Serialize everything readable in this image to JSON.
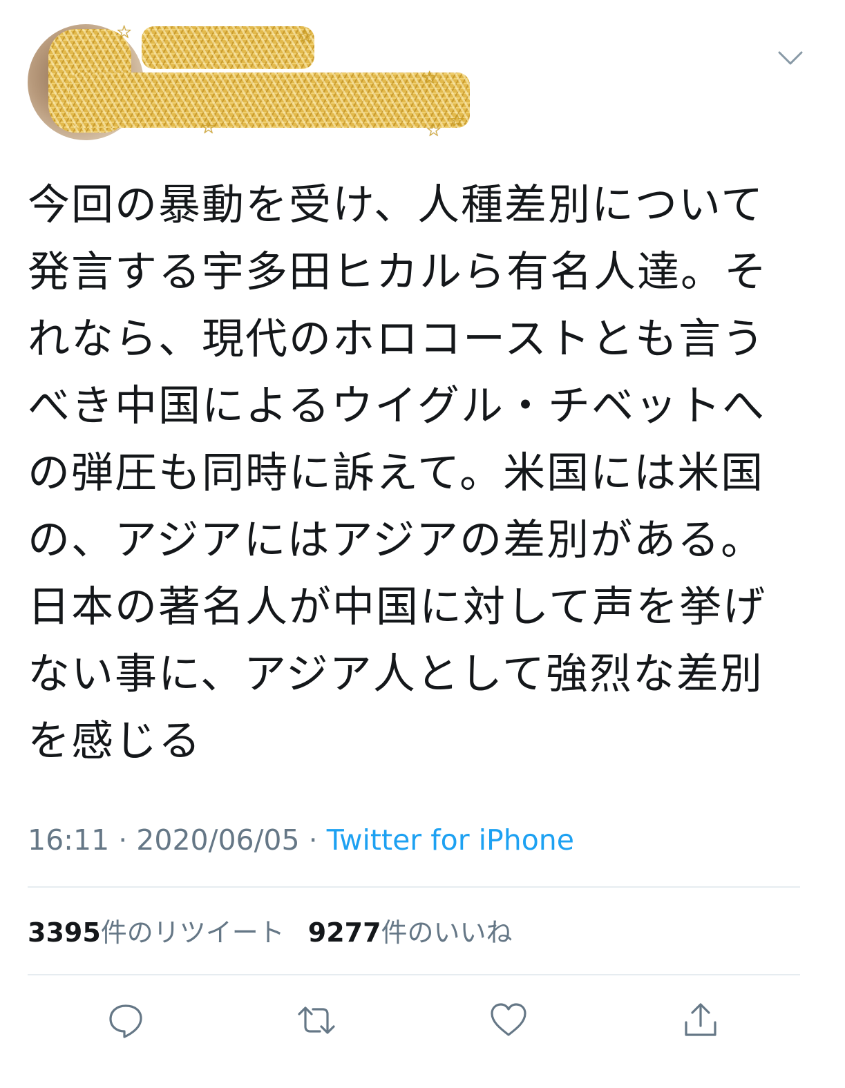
{
  "tweet": {
    "text": "今回の暴動を受け、人種差別について発言する宇多田ヒカルら有名人達。それなら、現代のホロコーストとも言うべき中国によるウイグル・チベットへの弾圧も同時に訴えて。米国には米国の、アジアにはアジアの差別がある。日本の著名人が中国に対して声を挙げない事に、アジア人として強烈な差別を感じる",
    "time": "16:11",
    "separator": "·",
    "date": "2020/06/05",
    "source": "Twitter for iPhone",
    "retweet_count": "3395",
    "retweet_label": "件のリツイート",
    "like_count": "9277",
    "like_label": "件のいいね"
  },
  "icons": {
    "menu": "chevron-down-icon",
    "reply": "reply-icon",
    "retweet": "retweet-icon",
    "like": "heart-icon",
    "share": "share-icon"
  },
  "colors": {
    "text": "#14171a",
    "secondary": "#657786",
    "link": "#1da1f2",
    "divider": "#e6ecf0",
    "redaction": "#e2b94c"
  }
}
